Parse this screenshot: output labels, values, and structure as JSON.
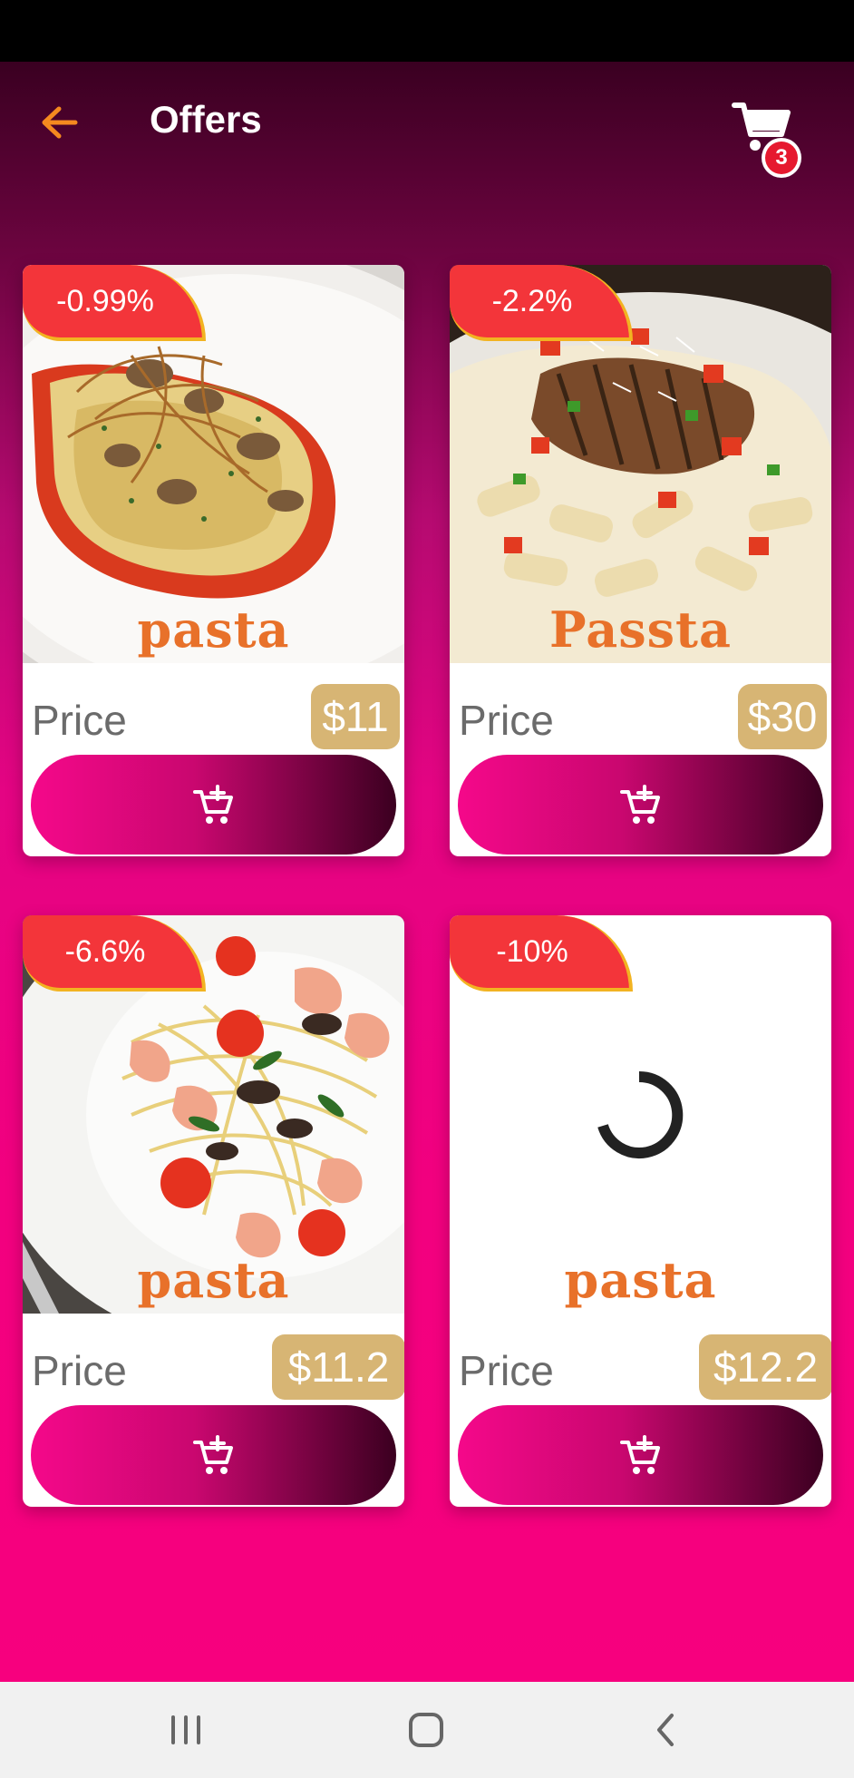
{
  "header": {
    "title": "Offers",
    "back_icon": "arrow-left-icon",
    "cart_icon": "shopping-cart-icon",
    "cart_count": "3"
  },
  "colors": {
    "accent_orange": "#f5891f",
    "discount_red": "#f3353a",
    "discount_border": "#f2b321",
    "price_gold": "#d7b574",
    "brand_orange": "#e8712a",
    "button_start": "#f5088a",
    "button_end": "#3b0020"
  },
  "offers": [
    {
      "discount": "-0.99%",
      "brand": "pasta",
      "price_label": "Price",
      "price": "$11",
      "add_icon": "add-to-cart-icon",
      "image": "ravioli-pasta-dish"
    },
    {
      "discount": "-2.2%",
      "brand": "Passta",
      "price_label": "Price",
      "price": "$30",
      "add_icon": "add-to-cart-icon",
      "image": "chicken-penne-pasta-dish"
    },
    {
      "discount": "-6.6%",
      "brand": "pasta",
      "price_label": "Price",
      "price": "$11.2",
      "add_icon": "add-to-cart-icon",
      "image": "shrimp-spaghetti-dish"
    },
    {
      "discount": "-10%",
      "brand": "pasta",
      "price_label": "Price",
      "price": "$12.2",
      "add_icon": "add-to-cart-icon",
      "image": "loading-spinner"
    }
  ],
  "navigation": {
    "recents_icon": "recent-apps-icon",
    "home_icon": "home-icon",
    "back_icon": "back-chevron-icon"
  }
}
